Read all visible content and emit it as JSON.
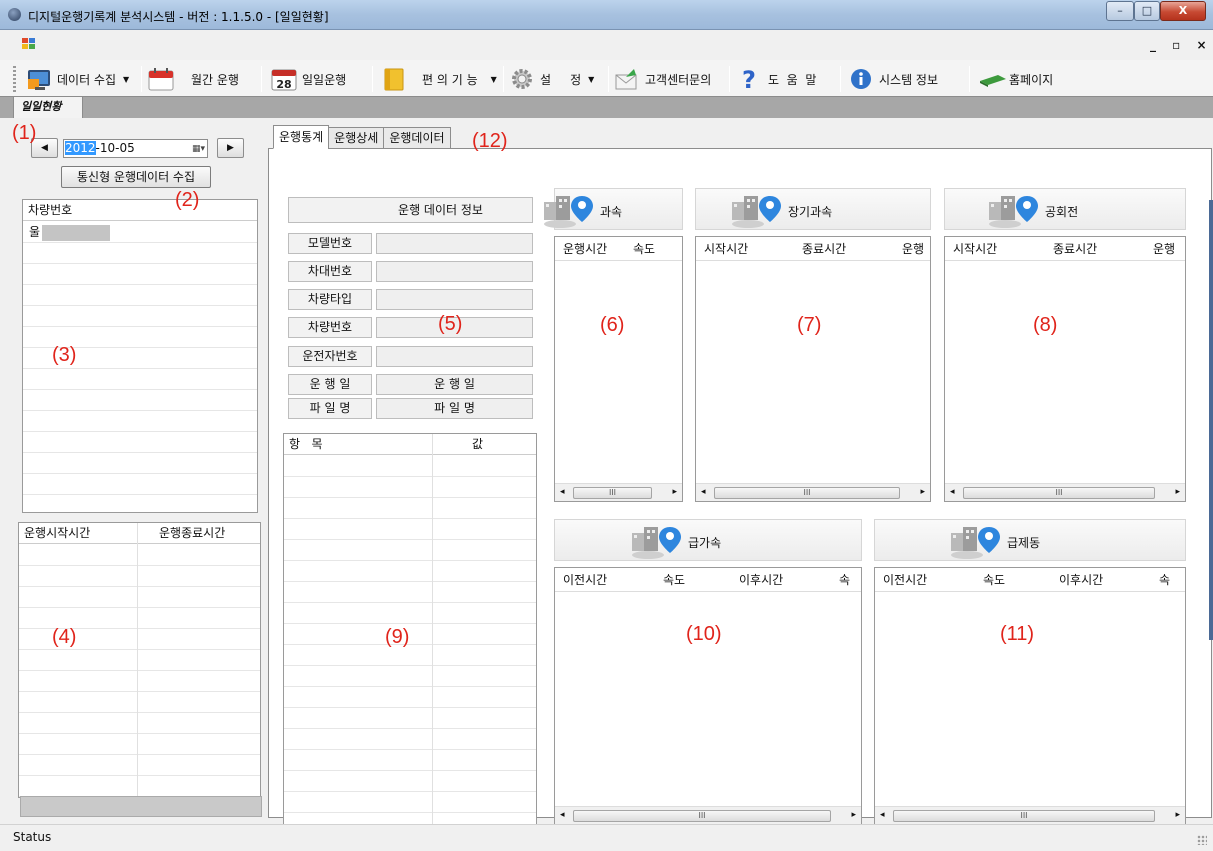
{
  "window": {
    "title": "디지털운행기록계 분석시스템 -  버전 : 1.1.5.0 - [일일현황]",
    "controls": {
      "minimize": "–",
      "maximize": "□",
      "close": "X"
    },
    "mdi_controls": "_ ▫ ×"
  },
  "toolbar": {
    "items": [
      {
        "label": "데이터 수집",
        "icon": "data-collect-icon",
        "dropdown": true
      },
      {
        "label": "월간 운행",
        "icon": "calendar-icon",
        "dropdown": false
      },
      {
        "label": "일일운행",
        "icon": "calendar-28-icon",
        "badge": "28",
        "dropdown": false
      },
      {
        "label": "편 의 기 능",
        "icon": "folder-icon",
        "dropdown": true
      },
      {
        "label": "설     정",
        "icon": "gear-icon",
        "dropdown": true
      },
      {
        "label": "고객센터문의",
        "icon": "mail-icon",
        "dropdown": false
      },
      {
        "label": "도  움  말",
        "icon": "help-icon",
        "dropdown": false
      },
      {
        "label": "시스템 정보",
        "icon": "info-icon",
        "dropdown": false
      },
      {
        "label": "홈페이지",
        "icon": "homepage-icon",
        "dropdown": false
      }
    ]
  },
  "mdi_tab": "일일현황",
  "left": {
    "date": {
      "selected_part": "2012",
      "rest": "-10-05"
    },
    "collect_button": "통신형 운행데이터 수집",
    "vehicle_grid": {
      "header": "차량번호",
      "rows": [
        "울"
      ]
    },
    "time_grid": {
      "headers": [
        "운행시작시간",
        "운행종료시간"
      ]
    }
  },
  "tabs": [
    "운행통계",
    "운행상세",
    "운행데이터"
  ],
  "info_panel": {
    "header": "운행 데이터 정보",
    "fields": [
      {
        "label": "모델번호",
        "value": ""
      },
      {
        "label": "차대번호",
        "value": ""
      },
      {
        "label": "차량타입",
        "value": ""
      },
      {
        "label": "차량번호",
        "value": ""
      },
      {
        "label": "운전자번호",
        "value": ""
      },
      {
        "label": "운 행 일",
        "value": "운 행 일"
      },
      {
        "label": "파 일 명",
        "value": "파 일 명"
      }
    ]
  },
  "item_grid": {
    "headers": [
      "항   목",
      "값"
    ]
  },
  "events": [
    {
      "title": "과속",
      "headers": [
        "운행시간",
        "속도"
      ]
    },
    {
      "title": "장기과속",
      "headers": [
        "시작시간",
        "종료시간",
        "운행"
      ]
    },
    {
      "title": "공회전",
      "headers": [
        "시작시간",
        "종료시간",
        "운행"
      ]
    },
    {
      "title": "급가속",
      "headers": [
        "이전시간",
        "속도",
        "이후시간",
        "속"
      ]
    },
    {
      "title": "급제동",
      "headers": [
        "이전시간",
        "속도",
        "이후시간",
        "속"
      ]
    }
  ],
  "scroll_thumb": "III",
  "annotations": [
    "(1)",
    "(2)",
    "(3)",
    "(4)",
    "(5)",
    "(6)",
    "(7)",
    "(8)",
    "(9)",
    "(10)",
    "(11)",
    "(12)"
  ],
  "status": "Status",
  "colors": {
    "annotation": "#e0241b",
    "title_bar": "#a7c1df",
    "selection": "#3399ff",
    "close_button": "#c74a33"
  }
}
